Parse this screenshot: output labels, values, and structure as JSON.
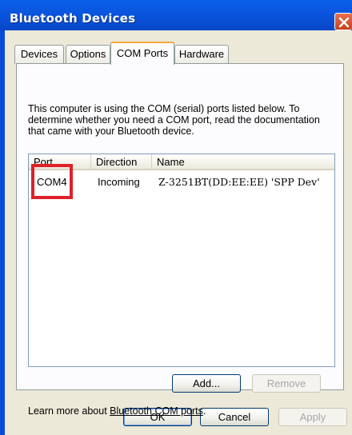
{
  "window": {
    "title": "Bluetooth Devices"
  },
  "tabs": [
    {
      "label": "Devices",
      "active": false
    },
    {
      "label": "Options",
      "active": false
    },
    {
      "label": "COM Ports",
      "active": true
    },
    {
      "label": "Hardware",
      "active": false
    }
  ],
  "panel": {
    "description": "This computer is using the COM (serial) ports listed below. To determine whether you need a COM port, read the documentation that came with your Bluetooth device.",
    "columns": [
      "Port",
      "Direction",
      "Name"
    ],
    "rows": [
      {
        "port": "COM4",
        "direction": "Incoming",
        "name": "Z-3251BT(DD:EE:EE) 'SPP Dev'"
      }
    ],
    "add_label": "Add...",
    "remove_label": "Remove",
    "learn_prefix": "Learn more about ",
    "learn_link": "Bluetooth COM ports",
    "learn_suffix": "."
  },
  "footer": {
    "ok_label": "OK",
    "cancel_label": "Cancel",
    "apply_label": "Apply"
  },
  "colors": {
    "titlebar": "#0a4ad6",
    "highlight": "#e0202a",
    "tab_accent": "#f1a93b"
  }
}
